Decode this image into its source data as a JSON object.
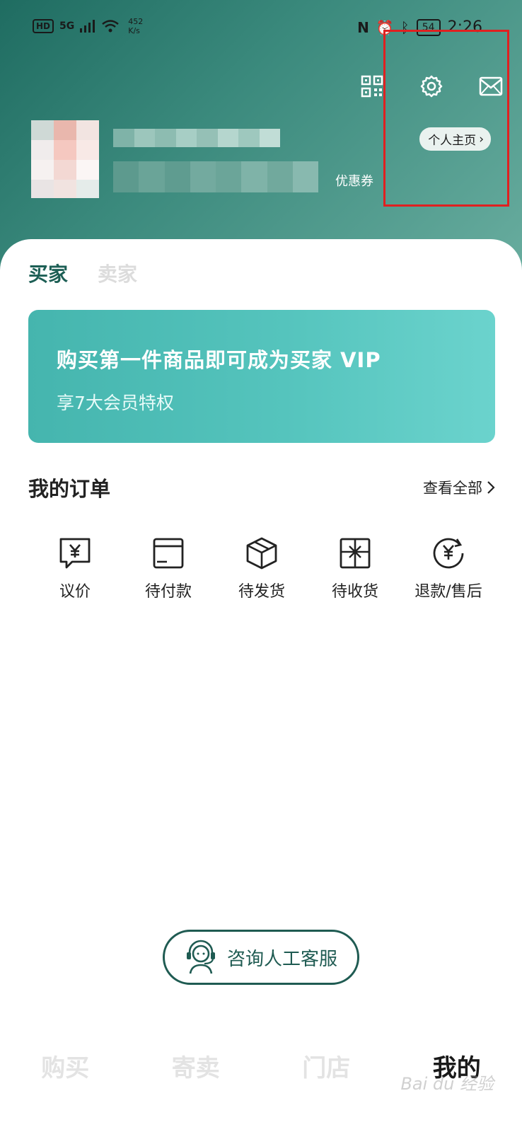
{
  "status_bar": {
    "hd": "HD",
    "signal": "5G",
    "net_speed_value": "452",
    "net_speed_unit": "K/s",
    "battery": "54",
    "time": "2:26"
  },
  "header": {
    "icons": [
      "qr-code-icon",
      "settings-icon",
      "mail-icon"
    ],
    "profile_button": "个人主页",
    "coupon_label": "优惠券"
  },
  "role_tabs": [
    {
      "label": "买家",
      "active": true
    },
    {
      "label": "卖家",
      "active": false
    }
  ],
  "vip_banner": {
    "title": "购买第一件商品即可成为买家 VIP",
    "subtitle": "享7大会员特权"
  },
  "orders": {
    "title": "我的订单",
    "view_all": "查看全部",
    "items": [
      {
        "label": "议价",
        "icon": "bargain-icon"
      },
      {
        "label": "待付款",
        "icon": "wallet-icon"
      },
      {
        "label": "待发货",
        "icon": "box-icon"
      },
      {
        "label": "待收货",
        "icon": "gift-icon"
      },
      {
        "label": "退款/售后",
        "icon": "refund-icon"
      }
    ]
  },
  "customer_service": {
    "label": "咨询人工客服",
    "icon": "headset-agent-icon"
  },
  "bottom_nav": [
    {
      "label": "购买",
      "active": false
    },
    {
      "label": "寄卖",
      "active": false
    },
    {
      "label": "门店",
      "active": false
    },
    {
      "label": "我的",
      "active": true
    }
  ],
  "colors": {
    "brand_dark": "#1d5f55",
    "banner": "#55c4bd",
    "highlight": "#e02020"
  }
}
